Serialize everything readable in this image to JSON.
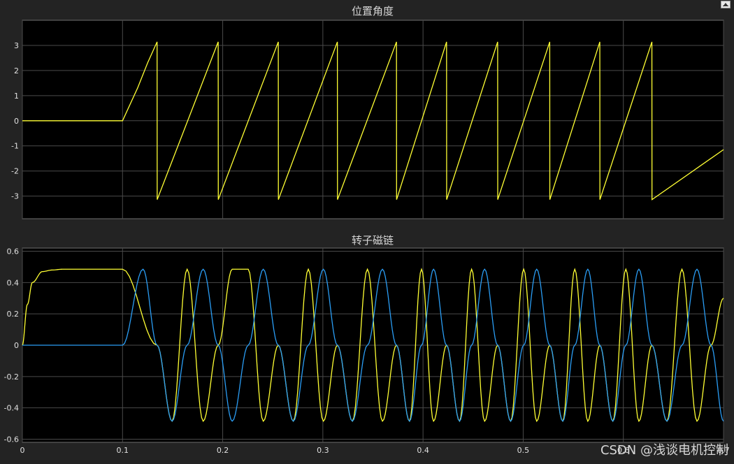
{
  "chart_data": [
    {
      "type": "line",
      "title": "位置角度",
      "xlim": [
        0,
        0.7
      ],
      "ylim": [
        -3.9,
        4.0
      ],
      "yticks": [
        3,
        2,
        1,
        0,
        -1,
        -2,
        -3
      ],
      "ytick_labels": [
        "3",
        "2",
        "1",
        "0",
        "-1",
        "-2",
        "-3"
      ],
      "grid": true,
      "series": [
        {
          "color": "#ffff33",
          "x": [
            0,
            0.1,
            0.115,
            0.125,
            0.1345,
            0.1346,
            0.1955,
            0.1956,
            0.2555,
            0.2556,
            0.3145,
            0.3146,
            0.3735,
            0.3736,
            0.4235,
            0.4236,
            0.4745,
            0.4746,
            0.5265,
            0.5266,
            0.5765,
            0.5766,
            0.6285,
            0.6286,
            0.7
          ],
          "y": [
            0,
            0,
            1.3,
            2.3,
            3.14,
            -3.14,
            3.14,
            -3.14,
            3.14,
            -3.14,
            3.14,
            -3.14,
            3.14,
            -3.14,
            3.14,
            -3.14,
            3.14,
            -3.14,
            3.14,
            -3.14,
            3.14,
            -3.14,
            3.14,
            -3.14,
            -1.15
          ]
        }
      ]
    },
    {
      "type": "line",
      "title": "转子磁链",
      "xlim": [
        0,
        0.7
      ],
      "ylim": [
        -0.62,
        0.62
      ],
      "yticks": [
        0.6,
        0.4,
        0.2,
        0,
        -0.2,
        -0.4,
        -0.6
      ],
      "ytick_labels": [
        "0.6",
        "0.4",
        "0.2",
        "0",
        "-0.2",
        "-0.4",
        "-0.6"
      ],
      "xticks": [
        0,
        0.1,
        0.2,
        0.3,
        0.4,
        0.5,
        0.6,
        0.7
      ],
      "xtick_labels": [
        "0",
        "0.1",
        "0.2",
        "0.3",
        "0.4",
        "0.5",
        "0.6",
        "0.7"
      ],
      "grid": true,
      "amplitude": 0.485,
      "series": [
        {
          "color": "#ffff33",
          "x": [
            0,
            0.005,
            0.01,
            0.02,
            0.03,
            0.04,
            0.1,
            0.1345,
            0.1495,
            0.1645,
            0.1805,
            0.1955,
            0.2095,
            0.2255,
            0.2405,
            0.2555,
            0.2705,
            0.2855,
            0.3005,
            0.3145,
            0.3295,
            0.3445,
            0.3595,
            0.3735,
            0.3865,
            0.3985,
            0.4105,
            0.4235,
            0.4365,
            0.4485,
            0.4615,
            0.4745,
            0.4875,
            0.5005,
            0.5135,
            0.5265,
            0.5395,
            0.5515,
            0.5645,
            0.5765,
            0.5895,
            0.6025,
            0.6155,
            0.6285,
            0.6435,
            0.6585,
            0.6735,
            0.6875,
            0.7
          ],
          "y": [
            0,
            0.26,
            0.4,
            0.47,
            0.48,
            0.485,
            0.485,
            0,
            -0.485,
            0.485,
            -0.485,
            0,
            0.485,
            0.485,
            -0.485,
            0,
            -0.485,
            0.485,
            -0.485,
            0,
            -0.485,
            0.485,
            -0.485,
            0,
            -0.485,
            0.485,
            -0.485,
            0,
            -0.485,
            0.485,
            -0.485,
            0,
            -0.485,
            0.485,
            -0.485,
            0,
            -0.485,
            0.485,
            -0.485,
            0,
            -0.485,
            0.485,
            -0.485,
            0,
            -0.485,
            0.485,
            -0.485,
            0,
            0.3
          ]
        },
        {
          "color": "#2a9df4",
          "x": [
            0,
            0.1,
            0.1205,
            0.1345,
            0.1495,
            0.1645,
            0.1805,
            0.1955,
            0.2095,
            0.2255,
            0.2405,
            0.2555,
            0.2705,
            0.2855,
            0.3005,
            0.3145,
            0.3295,
            0.3445,
            0.3595,
            0.3735,
            0.3865,
            0.3985,
            0.4105,
            0.4235,
            0.4365,
            0.4485,
            0.4615,
            0.4745,
            0.4875,
            0.5005,
            0.5135,
            0.5265,
            0.5395,
            0.5515,
            0.5645,
            0.5765,
            0.5895,
            0.6025,
            0.6155,
            0.6285,
            0.6435,
            0.6585,
            0.6735,
            0.6875,
            0.7
          ],
          "y": [
            0,
            0,
            0.485,
            0,
            -0.485,
            0,
            0.485,
            0,
            -0.485,
            0,
            0.485,
            0,
            -0.485,
            0,
            0.485,
            0,
            -0.485,
            0,
            0.485,
            0,
            -0.485,
            0,
            0.485,
            0,
            -0.485,
            0,
            0.485,
            0,
            -0.485,
            0,
            0.485,
            0,
            -0.485,
            0,
            0.485,
            0,
            -0.485,
            0,
            0.485,
            0,
            -0.485,
            0,
            0.485,
            0,
            -0.485
          ]
        }
      ]
    }
  ],
  "watermark": "CSDN @浅谈电机控制"
}
